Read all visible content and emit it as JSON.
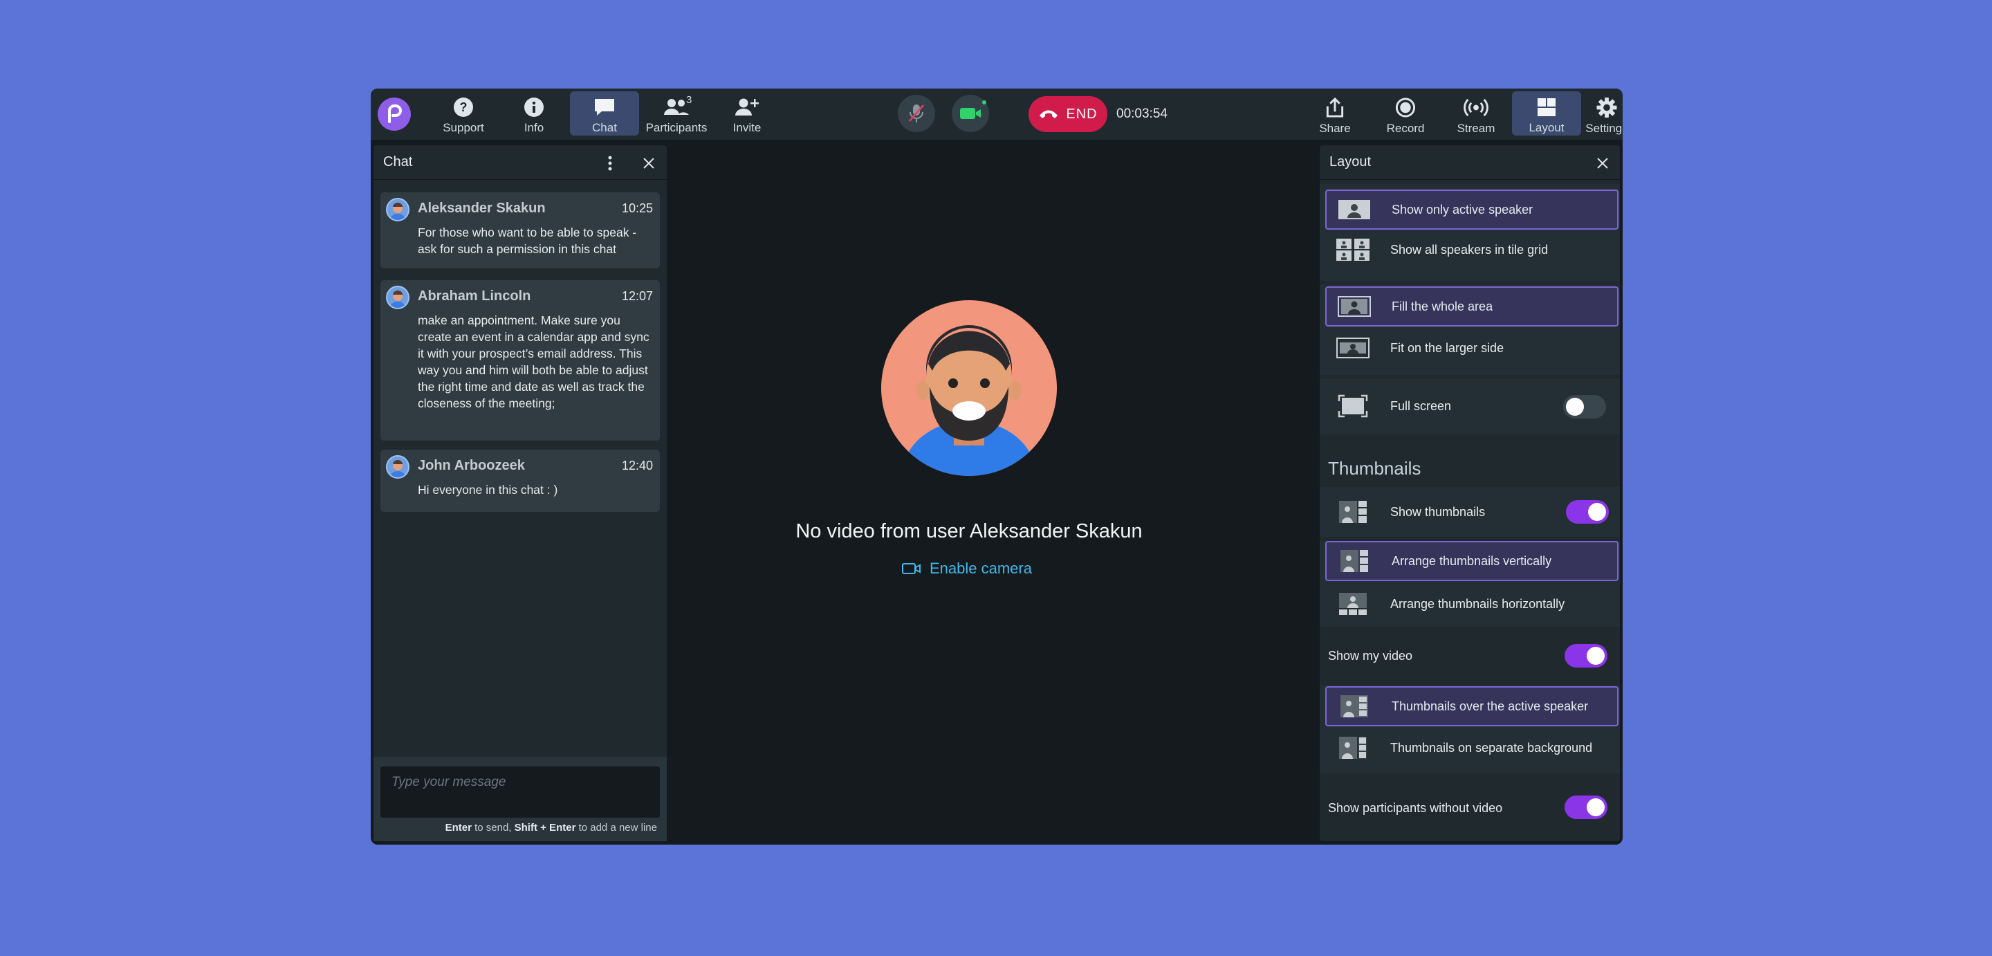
{
  "topbar": {
    "left_buttons": [
      {
        "label": "Support",
        "icon": "help-icon"
      },
      {
        "label": "Info",
        "icon": "info-icon"
      },
      {
        "label": "Chat",
        "icon": "chat-icon",
        "active": true
      },
      {
        "label": "Participants",
        "icon": "participants-icon",
        "badge": "3"
      },
      {
        "label": "Invite",
        "icon": "invite-icon"
      }
    ],
    "end_label": "END",
    "timer": "00:03:54",
    "right_buttons": [
      {
        "label": "Share",
        "icon": "share-icon"
      },
      {
        "label": "Record",
        "icon": "record-icon"
      },
      {
        "label": "Stream",
        "icon": "stream-icon"
      },
      {
        "label": "Layout",
        "icon": "layout-icon",
        "active": true
      },
      {
        "label": "Settings",
        "icon": "settings-icon"
      }
    ]
  },
  "chat": {
    "title": "Chat",
    "messages": [
      {
        "name": "Aleksander Skakun",
        "time": "10:25",
        "text": "For those who want to be able to speak - ask for such a permission in this chat"
      },
      {
        "name": "Abraham Lincoln",
        "time": "12:07",
        "text": "make an appointment. Make sure you create an event in a calendar app and sync it with your prospect’s email address. This way you and him will both be able to adjust the right time and date as well as track the closeness of the meeting;"
      },
      {
        "name": "John Arboozeek",
        "time": "12:40",
        "text": "Hi everyone in this chat : )"
      }
    ],
    "input_placeholder": "Type your message",
    "hint_key1": "Enter",
    "hint_mid": " to send, ",
    "hint_key2": "Shift + Enter",
    "hint_end": " to add a new line"
  },
  "center": {
    "no_video_text": "No video from user Aleksander Skakun",
    "enable_camera": "Enable camera"
  },
  "layout": {
    "title": "Layout",
    "view_options": [
      {
        "label": "Show only active speaker",
        "selected": true
      },
      {
        "label": "Show all speakers in tile grid",
        "selected": false
      }
    ],
    "fit_options": [
      {
        "label": "Fill the whole area",
        "selected": true
      },
      {
        "label": "Fit on the larger side",
        "selected": false
      }
    ],
    "full_screen": {
      "label": "Full screen",
      "on": false
    },
    "thumbnails_title": "Thumbnails",
    "show_thumbnails": {
      "label": "Show thumbnails",
      "on": true
    },
    "arrange_options": [
      {
        "label": "Arrange thumbnails vertically",
        "selected": true
      },
      {
        "label": "Arrange thumbnails horizontally",
        "selected": false
      }
    ],
    "show_my_video": {
      "label": "Show my video",
      "on": true
    },
    "placement_options": [
      {
        "label": "Thumbnails over the active speaker",
        "selected": true
      },
      {
        "label": "Thumbnails on separate background",
        "selected": false
      }
    ],
    "show_without_video": {
      "label": "Show participants without video",
      "on": true
    }
  },
  "colors": {
    "accent": "#8b35e8",
    "end": "#d11c4b",
    "link": "#3fb8e8",
    "background": "#5c74d8"
  }
}
